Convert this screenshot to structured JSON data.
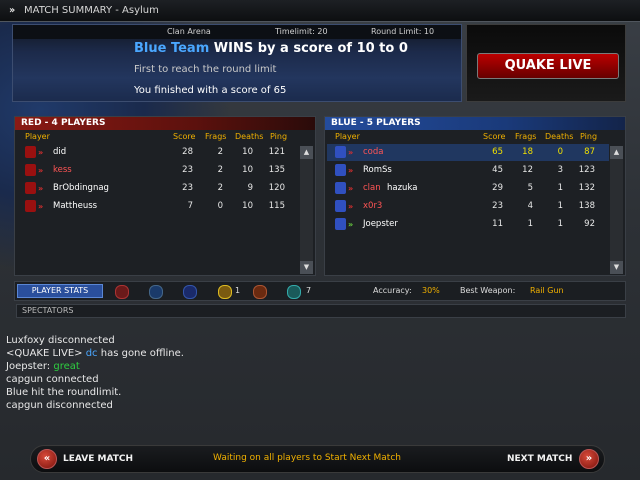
{
  "window": {
    "title": "MATCH SUMMARY - Asylum"
  },
  "summary": {
    "header": {
      "gametype": "Clan Arena",
      "timelimit": "Timelimit:  20",
      "roundlimit": "Round Limit: 10"
    },
    "winner_team": "Blue Team",
    "winner_text": " WINS by a score of 10 to 0",
    "reason": "First to reach the round limit",
    "your_score": "You finished with a score of 65"
  },
  "logo": {
    "text": "QUAKE LIVE"
  },
  "red": {
    "title": "RED - 4 PLAYERS",
    "columns": {
      "player": "Player",
      "score": "Score",
      "frags": "Frags",
      "deaths": "Deaths",
      "ping": "Ping"
    },
    "players": [
      {
        "name": "did",
        "name_color": "#ffffff",
        "score": "28",
        "frags": "2",
        "deaths": "10",
        "ping": "121"
      },
      {
        "name": "kess",
        "name_color": "#ff5555",
        "score": "23",
        "frags": "2",
        "deaths": "10",
        "ping": "135"
      },
      {
        "name": "BrObdingnag",
        "name_color": "#ffffff",
        "score": "23",
        "frags": "2",
        "deaths": "9",
        "ping": "120"
      },
      {
        "name": "Mattheuss",
        "name_color": "#ffffff",
        "score": "7",
        "frags": "0",
        "deaths": "10",
        "ping": "115"
      }
    ]
  },
  "blue": {
    "title": "BLUE - 5 PLAYERS",
    "columns": {
      "player": "Player",
      "score": "Score",
      "frags": "Frags",
      "deaths": "Deaths",
      "ping": "Ping"
    },
    "players": [
      {
        "name_prefix": "",
        "name": "coda",
        "name_color": "#ff5555",
        "score": "65",
        "frags": "18",
        "deaths": "0",
        "ping": "87"
      },
      {
        "name_prefix": "",
        "name": "RomSs",
        "name_color": "#ffffff",
        "score": "45",
        "frags": "12",
        "deaths": "3",
        "ping": "123"
      },
      {
        "name_prefix": "clan",
        "name": "hazuka",
        "name_color": "#ffffff",
        "score": "29",
        "frags": "5",
        "deaths": "1",
        "ping": "132"
      },
      {
        "name_prefix": "",
        "name": "x0r3",
        "name_color": "#ff5555",
        "score": "23",
        "frags": "4",
        "deaths": "1",
        "ping": "138"
      },
      {
        "name_prefix": "",
        "name": "Joepster",
        "name_color": "#ffffff",
        "score": "11",
        "frags": "1",
        "deaths": "1",
        "ping": "92"
      }
    ]
  },
  "stats": {
    "button": "PLAYER STATS",
    "medal_count_a": "1",
    "medal_count_b": "7",
    "accuracy_label": "Accuracy:",
    "accuracy_value": "30%",
    "weapon_label": "Best Weapon:",
    "weapon_value": "Rail Gun"
  },
  "spectators": {
    "label": "SPECTATORS"
  },
  "chat": [
    {
      "parts": [
        {
          "t": "Luxfoxy disconnected",
          "c": "#e8e8e8"
        }
      ]
    },
    {
      "parts": [
        {
          "t": "<QUAKE LIVE> ",
          "c": "#e8e8e8"
        },
        {
          "t": "dc",
          "c": "#4aa7ff"
        },
        {
          "t": " has gone offline.",
          "c": "#e8e8e8"
        }
      ]
    },
    {
      "parts": [
        {
          "t": " Joepster: ",
          "c": "#e8e8e8"
        },
        {
          "t": "great",
          "c": "#2ecc40"
        }
      ]
    },
    {
      "parts": [
        {
          "t": "capgun connected",
          "c": "#e8e8e8"
        }
      ]
    },
    {
      "parts": [
        {
          "t": "Blue hit the roundlimit.",
          "c": "#e8e8e8"
        }
      ]
    },
    {
      "parts": [
        {
          "t": "capgun disconnected",
          "c": "#e8e8e8"
        }
      ]
    }
  ],
  "bottom": {
    "leave": "LEAVE MATCH",
    "waiting": "Waiting on all players to Start Next Match",
    "next": "NEXT MATCH"
  },
  "colors": {
    "red": "#8a1a14",
    "blue": "#244c9c",
    "accent_yellow": "#f0b000",
    "highlight_green": "#2ecc40"
  }
}
